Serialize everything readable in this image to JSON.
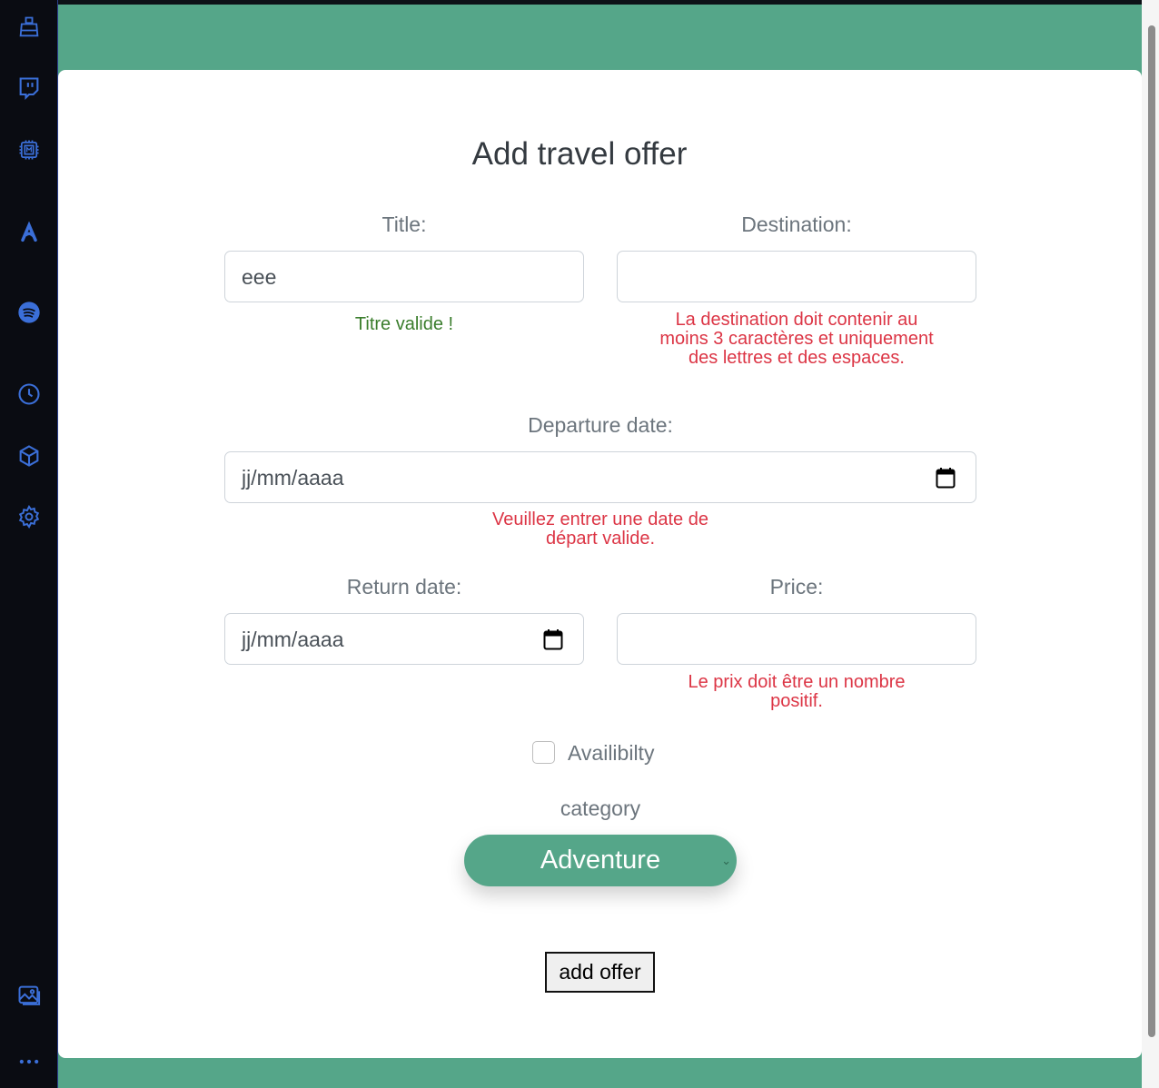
{
  "form": {
    "title": "Add travel offer",
    "title_field": {
      "label": "Title:",
      "value": "eee",
      "message": "Titre valide !"
    },
    "destination_field": {
      "label": "Destination:",
      "value": "",
      "message": "La destination doit contenir au moins 3 caractères et uniquement des lettres et des espaces."
    },
    "departure_field": {
      "label": "Departure date:",
      "placeholder": "jj/mm/aaaa",
      "message": "Veuillez entrer une date de départ valide."
    },
    "return_field": {
      "label": "Return date:",
      "placeholder": "jj/mm/aaaa"
    },
    "price_field": {
      "label": "Price:",
      "value": "",
      "message": "Le prix doit être un nombre positif."
    },
    "availability": {
      "label": "Availibilty",
      "checked": false
    },
    "category": {
      "label": "category",
      "selected": "Adventure"
    },
    "submit_label": "add offer"
  },
  "sidebar": {
    "icons": [
      "broom-icon",
      "twitch-icon",
      "chip-m-icon",
      "arc-logo-icon",
      "spotify-icon",
      "clock-icon",
      "cube-icon",
      "gear-icon",
      "image-gallery-icon",
      "more-icon"
    ]
  },
  "colors": {
    "accent": "#55a689",
    "valid": "#3a7d2c",
    "error": "#dc3545",
    "sidebar_icon": "#3b6fd8"
  }
}
